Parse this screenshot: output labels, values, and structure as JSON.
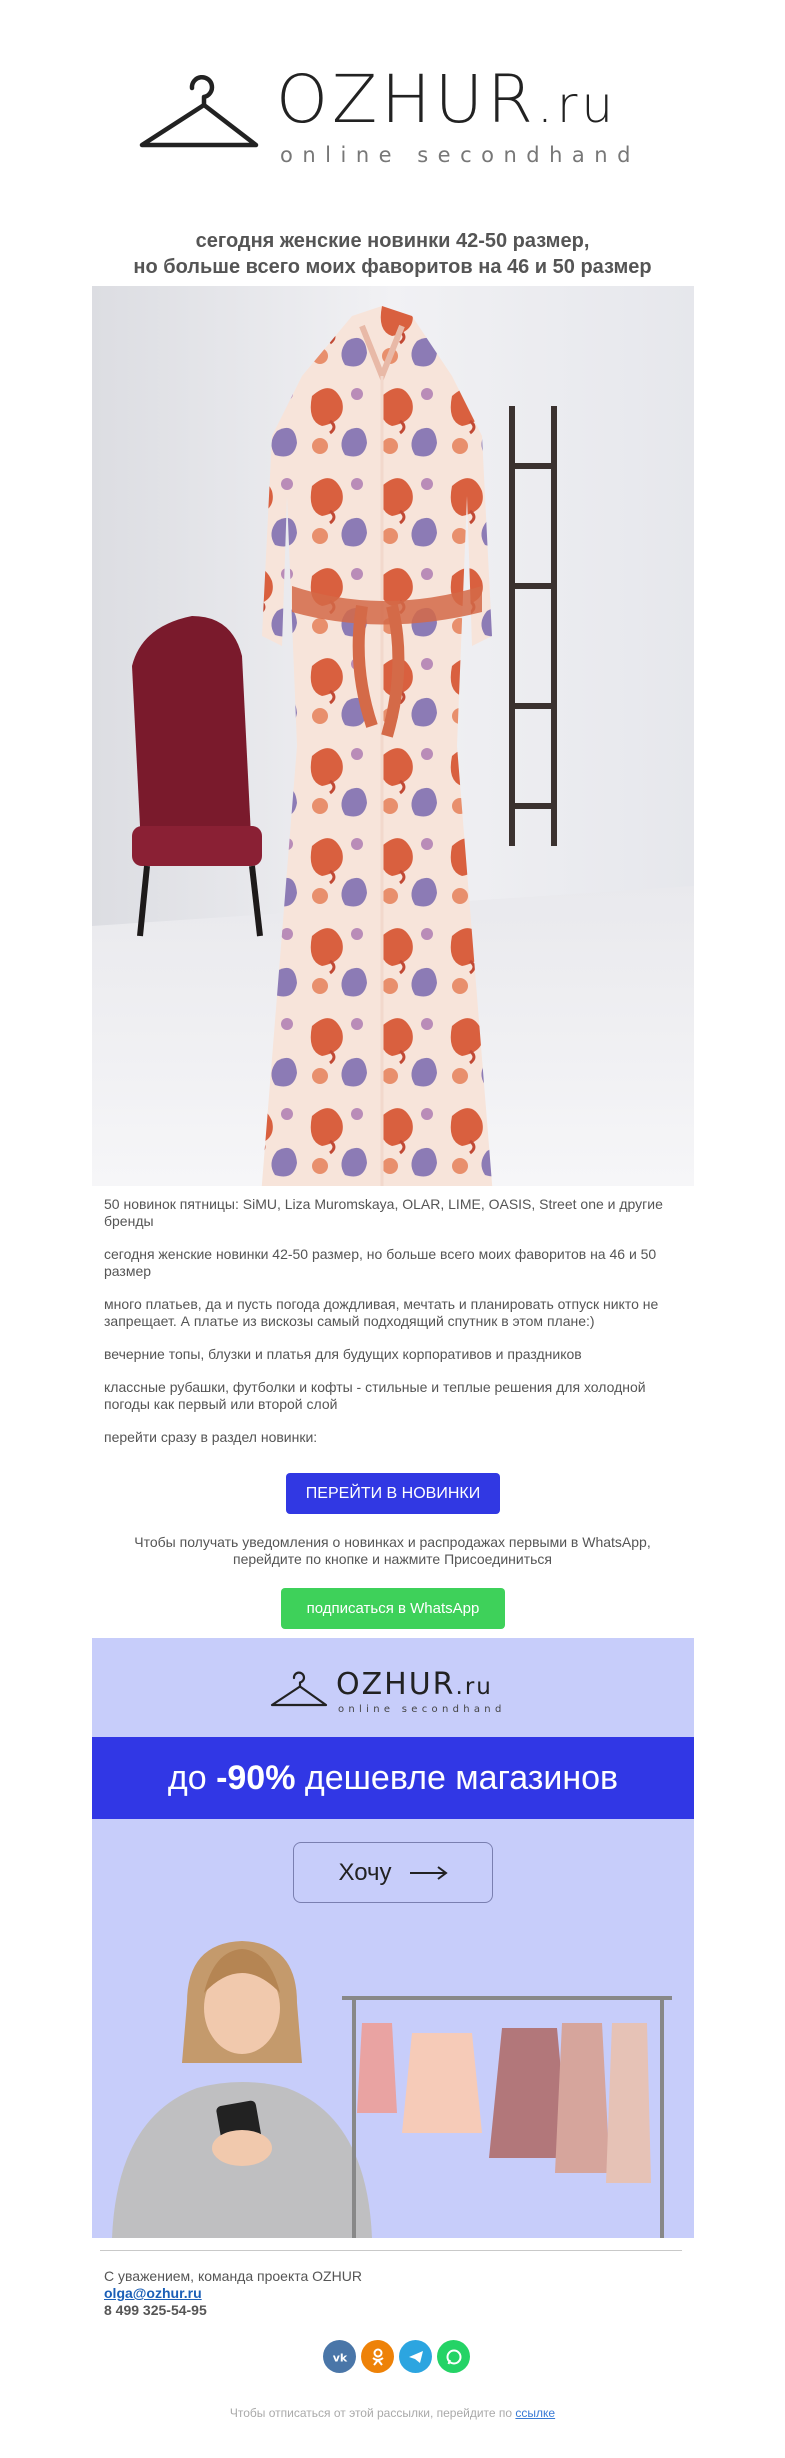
{
  "brand": {
    "name": "OZHUR",
    "tld": ".ru",
    "tagline": "online secondhand"
  },
  "headline": {
    "line1": "сегодня женские новинки 42-50 размер,",
    "line2": "но больше всего моих фаворитов на 46 и 50 размер"
  },
  "body": {
    "p1": "50 новинок пятницы: SiMU, Liza Muromskaya, OLAR, LIME, OASIS, Street one и другие бренды",
    "p2": "сегодня женские новинки 42-50 размер, но больше всего моих фаворитов на 46 и 50 размер",
    "p3": "много платьев, да и пусть погода дождливая, мечтать и планировать отпуск никто не запрещает. А платье из вискозы самый подходящий спутник в этом плане:)",
    "p4": "вечерние топы, блузки и платья для будущих корпоративов и праздников",
    "p5": "классные рубашки, футболки и кофты - стильные и теплые решения для холодной погоды как первый или второй слой",
    "p6": "перейти сразу в раздел новинки:"
  },
  "cta_new": {
    "label": "ПЕРЕЙТИ В НОВИНКИ"
  },
  "whatsapp": {
    "note_line1": "Чтобы получать уведомления о новинках и распродажах первыми в WhatsApp,",
    "note_line2": "перейдите по кнопке и нажмите Присоединиться",
    "button": "подписаться в WhatsApp"
  },
  "banner": {
    "prefix": "до ",
    "discount": "-90%",
    "suffix": " дешевле магазинов",
    "button": "Хочу"
  },
  "signature": {
    "line": "С уважением, команда проекта OZHUR",
    "email": "olga@ozhur.ru",
    "phone": "8 499 325-54-95"
  },
  "socials": [
    {
      "name": "vk-icon",
      "color": "#4a76a8"
    },
    {
      "name": "odnoklassniki-icon",
      "color": "#ee8208"
    },
    {
      "name": "telegram-icon",
      "color": "#2ca5e0"
    },
    {
      "name": "whatsapp-icon",
      "color": "#25d366"
    }
  ],
  "unsubscribe": {
    "text": "Чтобы отписаться от этой рассылки, перейдите по ",
    "link": "ссылке"
  },
  "colors": {
    "accent_blue": "#3138e3",
    "whatsapp_green": "#3ed15a",
    "banner_bg": "#c7cdfa"
  }
}
